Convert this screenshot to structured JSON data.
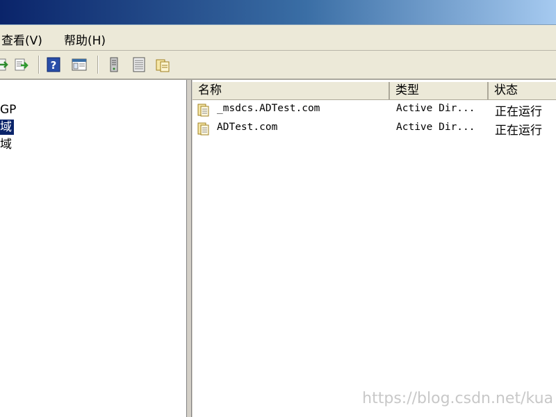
{
  "menu": {
    "view_label": "查看(V)",
    "help_label": "帮助(H)"
  },
  "toolbar": {
    "icons": [
      "back-forward-icon",
      "export-list-icon",
      "help-icon",
      "show-hide-console-tree-icon",
      "server-icon",
      "properties-icon",
      "new-zone-icon"
    ]
  },
  "tree": {
    "items": [
      {
        "label": "GP"
      },
      {
        "label": "域",
        "selected": true
      },
      {
        "label": "域"
      }
    ]
  },
  "list": {
    "columns": [
      "名称",
      "类型",
      "状态"
    ],
    "rows": [
      {
        "name": "_msdcs.ADTest.com",
        "type": "Active Dir...",
        "status": "正在运行"
      },
      {
        "name": "ADTest.com",
        "type": "Active Dir...",
        "status": "正在运行"
      }
    ]
  },
  "watermark": "https://blog.csdn.net/kua",
  "colors": {
    "title_gradient_start": "#0a246a",
    "title_gradient_end": "#a6caf0",
    "selection": "#0a246a",
    "chrome": "#ece9d8"
  }
}
